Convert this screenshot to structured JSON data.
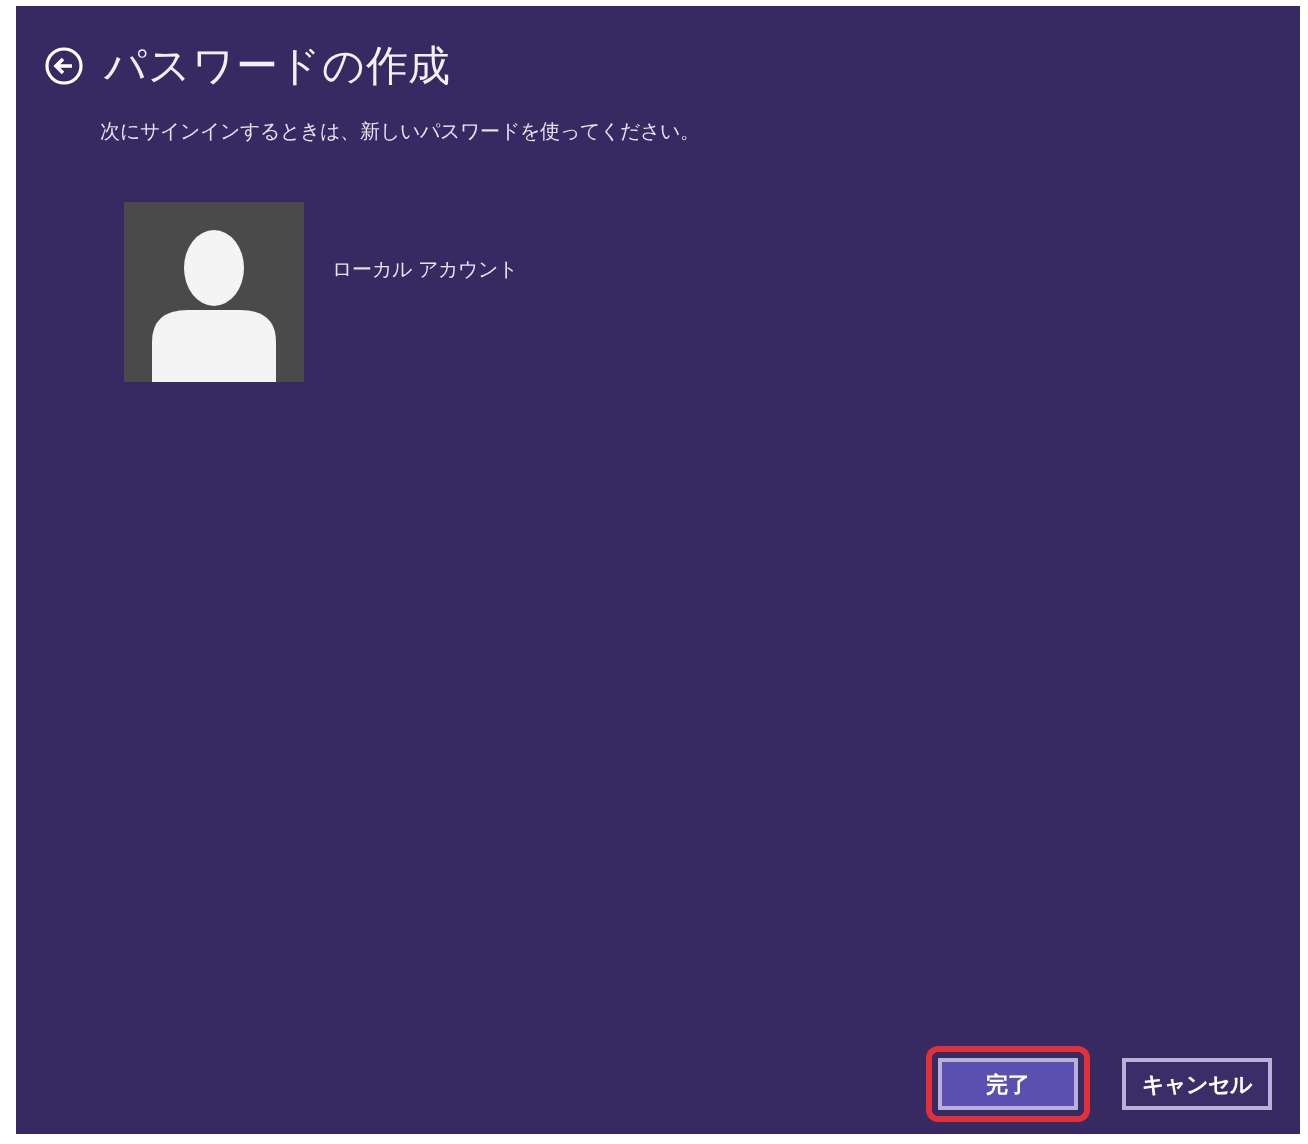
{
  "title": "パスワードの作成",
  "instruction": "次にサインインするときは、新しいパスワードを使ってください。",
  "account": {
    "type": "ローカル アカウント"
  },
  "buttons": [
    {
      "label": "完了",
      "highlighted": true
    },
    {
      "label": "キャンセル",
      "highlighted": false
    }
  ]
}
